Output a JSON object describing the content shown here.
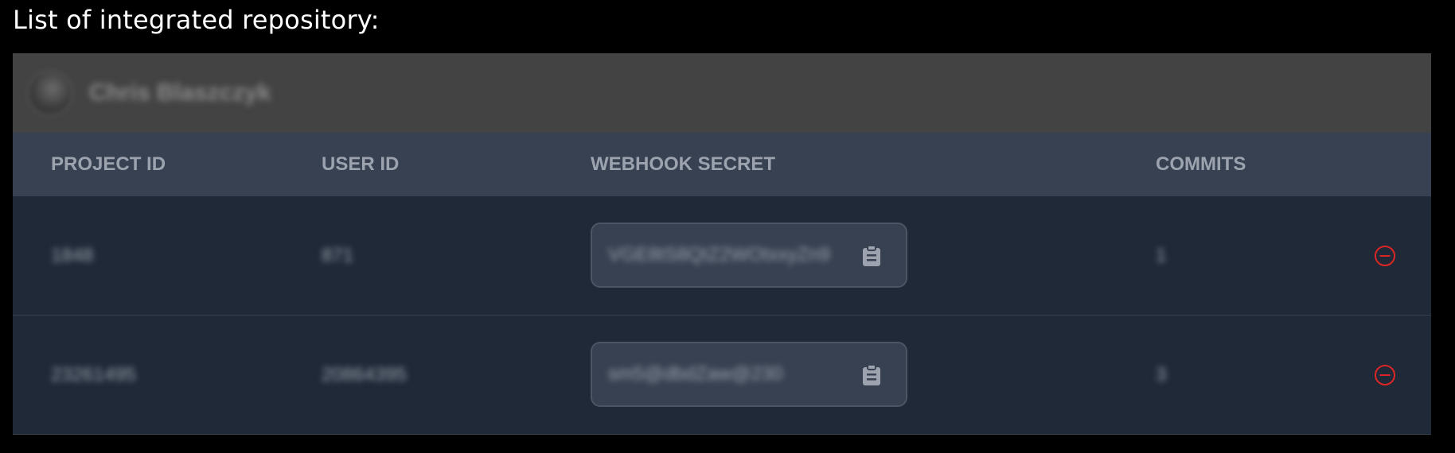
{
  "page": {
    "title": "List of integrated repository:"
  },
  "user": {
    "name": "Chris Blaszczyk"
  },
  "table": {
    "headers": {
      "project_id": "PROJECT ID",
      "user_id": "USER ID",
      "webhook_secret": "WEBHOOK SECRET",
      "commits": "COMMITS"
    },
    "rows": [
      {
        "project_id": "1848",
        "user_id": "871",
        "webhook_secret": "VGE8tS8QtZ2WOtxxyZn9",
        "commits": "1"
      },
      {
        "project_id": "23261495",
        "user_id": "20864395",
        "webhook_secret": "sm5@dbdZaw@230",
        "commits": "3"
      }
    ]
  },
  "colors": {
    "background": "#000000",
    "user_bar": "#434343",
    "table_header": "#374151",
    "table_body": "#1f2937",
    "header_text": "#9ca3af",
    "remove_icon": "#dc2626"
  },
  "icons": {
    "copy": "clipboard-icon",
    "remove": "remove-circle-icon"
  }
}
